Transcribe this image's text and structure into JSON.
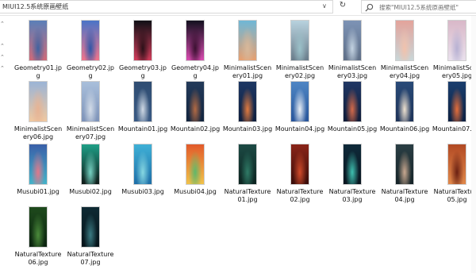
{
  "toolbar": {
    "path": "MIUI12.5系统原画壁纸",
    "dropdown_glyph": "∨",
    "refresh_glyph": "↻",
    "search_placeholder": "搜索\"MIUI12.5系统原画壁纸\""
  },
  "nav_pane": {
    "arrows": [
      "⌃",
      "⌃",
      "⌃",
      "⌃"
    ]
  },
  "files": [
    {
      "name": "Geometry01.jpg",
      "label": "Geometry01.jp\ng",
      "colors": [
        "#5a7fb8",
        "#3f63a0",
        "#d06a78"
      ]
    },
    {
      "name": "Geometry02.jpg",
      "label": "Geometry02.jp\ng",
      "colors": [
        "#4a74c7",
        "#2e56a8",
        "#f2748a"
      ]
    },
    {
      "name": "Geometry03.jpg",
      "label": "Geometry03.jp\ng",
      "colors": [
        "#101016",
        "#2a1018",
        "#d23c5a"
      ]
    },
    {
      "name": "Geometry04.jpg",
      "label": "Geometry04.jp\ng",
      "colors": [
        "#13101f",
        "#3a1030",
        "#d94bb0"
      ]
    },
    {
      "name": "MinimalistScenery01.jpg",
      "label": "MinimalistScen\nery01.jpg",
      "colors": [
        "#6fb7d6",
        "#d8b89a",
        "#e8a070"
      ]
    },
    {
      "name": "MinimalistScenery02.jpg",
      "label": "MinimalistScen\nery02.jpg",
      "colors": [
        "#b8d2de",
        "#9bc1c9",
        "#6a7c8a"
      ]
    },
    {
      "name": "MinimalistScenery03.jpg",
      "label": "MinimalistScen\nery03.jpg",
      "colors": [
        "#7d93b5",
        "#c4d3e2",
        "#5f6f87"
      ]
    },
    {
      "name": "MinimalistScenery04.jpg",
      "label": "MinimalistScen\nery04.jpg",
      "colors": [
        "#e3a39b",
        "#f2c2ac",
        "#c9d6d8"
      ]
    },
    {
      "name": "MinimalistScenery05.jpg",
      "label": "MinimalistScen\nery05.jpg",
      "colors": [
        "#d9b8c8",
        "#b7b1d3",
        "#e9e0ec"
      ]
    },
    {
      "name": "MinimalistScenery06.jpg",
      "label": "MinimalistScen\nery06.jpg",
      "colors": [
        "#9bb4d6",
        "#e7b393",
        "#f0c8a0"
      ]
    },
    {
      "name": "MinimalistScenery07.jpg",
      "label": "MinimalistScen\nery07.jpg",
      "colors": [
        "#a9bfdb",
        "#d3dce8",
        "#7e93b8"
      ]
    },
    {
      "name": "Mountain01.jpg",
      "label": "Mountain01.jpg",
      "colors": [
        "#2f4d72",
        "#cfd9e4",
        "#3a5a84"
      ]
    },
    {
      "name": "Mountain02.jpg",
      "label": "Mountain02.jpg",
      "colors": [
        "#233a5a",
        "#b26a44",
        "#12243e"
      ]
    },
    {
      "name": "Mountain03.jpg",
      "label": "Mountain03.jpg",
      "colors": [
        "#1d3763",
        "#e07a3f",
        "#0f1f3e"
      ]
    },
    {
      "name": "Mountain04.jpg",
      "label": "Mountain04.jpg",
      "colors": [
        "#4f86c4",
        "#e8eef5",
        "#28559a"
      ]
    },
    {
      "name": "Mountain05.jpg",
      "label": "Mountain05.jpg",
      "colors": [
        "#203764",
        "#d46a4a",
        "#101c38"
      ]
    },
    {
      "name": "Mountain06.jpg",
      "label": "Mountain06.jpg",
      "colors": [
        "#294a78",
        "#efe2d0",
        "#1e3358"
      ]
    },
    {
      "name": "Mountain07.jpg",
      "label": "Mountain07.jpg",
      "colors": [
        "#1a3e6e",
        "#e46d3a",
        "#0e2142"
      ]
    },
    {
      "name": "Musubi01.jpg",
      "label": "Musubi01.jpg",
      "colors": [
        "#3a5fa8",
        "#e0788a",
        "#44b3c9"
      ]
    },
    {
      "name": "Musubi02.jpg",
      "label": "Musubi02.jpg",
      "colors": [
        "#1e9e86",
        "#76d2c2",
        "#101a18"
      ]
    },
    {
      "name": "Musubi03.jpg",
      "label": "Musubi03.jpg",
      "colors": [
        "#3fb0d6",
        "#87d8e2",
        "#1f6fa8"
      ]
    },
    {
      "name": "Musubi04.jpg",
      "label": "Musubi04.jpg",
      "colors": [
        "#e25a2a",
        "#5fb86a",
        "#f0c24a"
      ]
    },
    {
      "name": "NaturalTexture01.jpg",
      "label": "NaturalTexture\n01.jpg",
      "colors": [
        "#1c4a44",
        "#2f7a66",
        "#0c2420"
      ]
    },
    {
      "name": "NaturalTexture02.jpg",
      "label": "NaturalTexture\n02.jpg",
      "colors": [
        "#8a2418",
        "#d04a2a",
        "#3a0e0a"
      ]
    },
    {
      "name": "NaturalTexture03.jpg",
      "label": "NaturalTexture\n03.jpg",
      "colors": [
        "#0e2a3a",
        "#3ec0b0",
        "#0a1620"
      ]
    },
    {
      "name": "NaturalTexture04.jpg",
      "label": "NaturalTexture\n04.jpg",
      "colors": [
        "#2a3e44",
        "#c8a890",
        "#162428"
      ]
    },
    {
      "name": "NaturalTexture05.jpg",
      "label": "NaturalTexture\n05.jpg",
      "colors": [
        "#b24a24",
        "#6a2012",
        "#e0884a"
      ]
    },
    {
      "name": "NaturalTexture06.jpg",
      "label": "NaturalTexture\n06.jpg",
      "colors": [
        "#1e4a1c",
        "#4a8a3a",
        "#0c2410"
      ]
    },
    {
      "name": "NaturalTexture07.jpg",
      "label": "NaturalTexture\n07.jpg",
      "colors": [
        "#0e2a34",
        "#3a7a82",
        "#06141a"
      ]
    }
  ]
}
